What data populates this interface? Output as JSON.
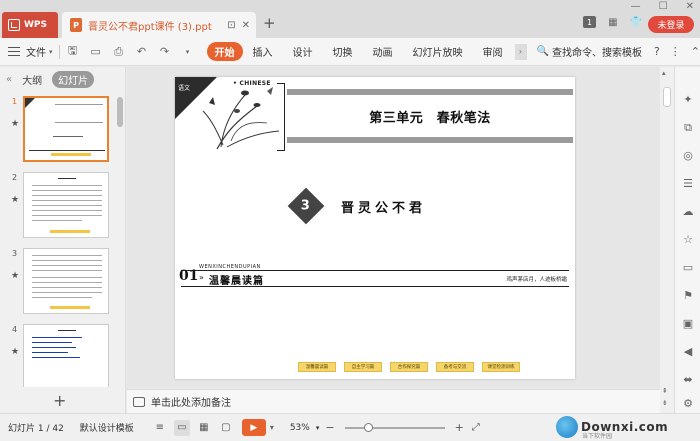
{
  "titlebar": {
    "app_name": "WPS",
    "doc_title": "晋灵公不君ppt课件 (3).ppt",
    "new_tab": "+",
    "badge_number": "1",
    "login_label": "未登录"
  },
  "menubar": {
    "file_label": "文件",
    "tabs": [
      "开始",
      "插入",
      "设计",
      "切换",
      "动画",
      "幻灯片放映",
      "审阅"
    ],
    "active_tab": "开始",
    "search_label": "查找命令、搜索模板"
  },
  "leftpanel": {
    "tab_outline": "大纲",
    "tab_slides": "幻灯片",
    "thumbnails": [
      {
        "num": "1"
      },
      {
        "num": "2"
      },
      {
        "num": "3"
      },
      {
        "num": "4"
      }
    ]
  },
  "slide": {
    "corner_tag": "语文",
    "english_label": "• CHINESE",
    "unit_title": "第三单元　春秋笔法",
    "lesson_number": "3",
    "lesson_title": "晋灵公不君",
    "section_number": "01",
    "section_pinyin": "WENXINCHENDUPIAN",
    "section_chevrons": "»",
    "section_title": "温馨晨读篇",
    "section_right": "鸡声茅店月，人迹板桥霜",
    "bottom_buttons": [
      "温馨晨读篇",
      "自主学习篇",
      "合作探究篇",
      "备考与交流",
      "课堂检测训练"
    ]
  },
  "notes": {
    "placeholder": "单击此处添加备注"
  },
  "statusbar": {
    "slide_count": "幻灯片 1 / 42",
    "design_template": "默认设计模板",
    "zoom_value": 53,
    "zoom_label": "53%",
    "zoom_minus": "−",
    "zoom_plus": "+"
  },
  "watermark": {
    "text": "Downxi.com",
    "sub": "当下软件园"
  },
  "colors": {
    "accent": "#e8622d",
    "login": "#e0493b",
    "wps_tab": "#d04b3a",
    "bottom_buttons": "#f5d66b"
  }
}
